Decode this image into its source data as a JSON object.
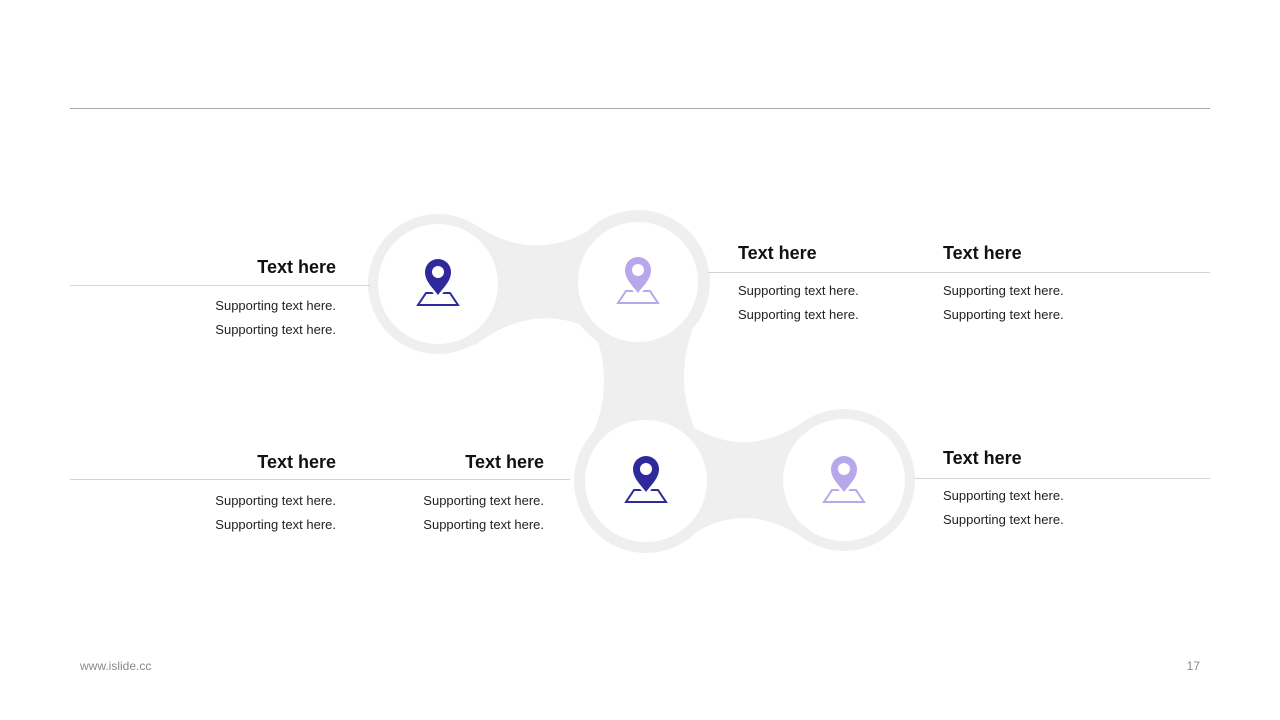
{
  "blocks": [
    {
      "id": "top-left",
      "title": "Text here",
      "line1": "Supporting text here.",
      "line2": "Supporting text here."
    },
    {
      "id": "top-mid",
      "title": "Text here",
      "line1": "Supporting text here.",
      "line2": "Supporting text here."
    },
    {
      "id": "top-right",
      "title": "Text here",
      "line1": "Supporting text here.",
      "line2": "Supporting text here."
    },
    {
      "id": "bottom-left",
      "title": "Text here",
      "line1": "Supporting text here.",
      "line2": "Supporting text here."
    },
    {
      "id": "bottom-mid",
      "title": "Text here",
      "line1": "Supporting text here.",
      "line2": "Supporting text here."
    },
    {
      "id": "bottom-right",
      "title": "Text here",
      "line1": "Supporting text here.",
      "line2": "Supporting text here."
    }
  ],
  "pins": [
    {
      "icon": "map-pin-icon",
      "color": "#2e2a9c"
    },
    {
      "icon": "map-pin-icon",
      "color": "#b6a8ea"
    },
    {
      "icon": "map-pin-icon",
      "color": "#2e2a9c"
    },
    {
      "icon": "map-pin-icon",
      "color": "#b6a8ea"
    }
  ],
  "colors": {
    "dark_pin": "#2e2a9c",
    "light_pin": "#b6a8ea",
    "ring": "#efefef",
    "rule": "#d4d4d4"
  },
  "footer": {
    "website": "www.islide.cc",
    "page_number": "17"
  }
}
